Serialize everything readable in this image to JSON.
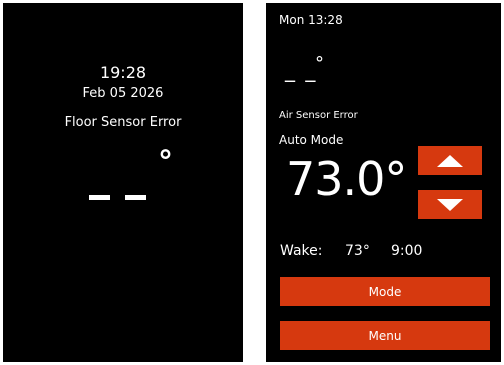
{
  "colors": {
    "background": "#000000",
    "text": "#ffffff",
    "accent": "#d6390f",
    "frame": "#ffffff"
  },
  "left_screen": {
    "time": "19:28",
    "date": "Feb 05 2026",
    "error": "Floor Sensor Error",
    "temperature_degree": "°"
  },
  "right_screen": {
    "clock": "Mon 13:28",
    "floor_temperature": "_ _",
    "floor_degree": "°",
    "air_error": "Air Sensor Error",
    "mode": "Auto Mode",
    "setpoint": "73.0°",
    "up_icon": "triangle-up-icon",
    "down_icon": "triangle-down-icon",
    "wake_label": "Wake:",
    "wake_temp": "73°",
    "wake_time": "9:00",
    "mode_button": "Mode",
    "menu_button": "Menu"
  }
}
